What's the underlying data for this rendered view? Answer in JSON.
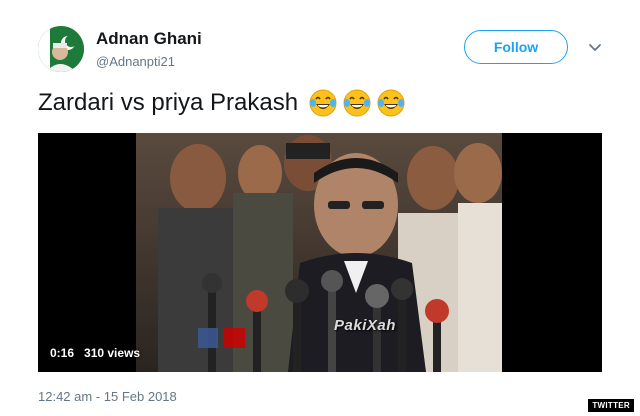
{
  "author": {
    "display_name": "Adnan Ghani",
    "handle": "@Adnanpti21",
    "avatar_icon": "profile-avatar-with-flag"
  },
  "follow_button": {
    "label": "Follow",
    "color": "#1da1f2"
  },
  "menu_icon": "chevron-down-icon",
  "tweet": {
    "text": "Zardari vs priya Prakash",
    "emojis": [
      "face-with-tears-of-joy",
      "face-with-tears-of-joy",
      "face-with-tears-of-joy"
    ]
  },
  "video": {
    "duration": "0:16",
    "views": "310 views",
    "watermark": "PakiXah"
  },
  "timestamp": "12:42 am - 15 Feb 2018",
  "credit": "TWITTER",
  "colors": {
    "text_primary": "#14171a",
    "text_secondary": "#657786",
    "accent": "#1da1f2"
  }
}
